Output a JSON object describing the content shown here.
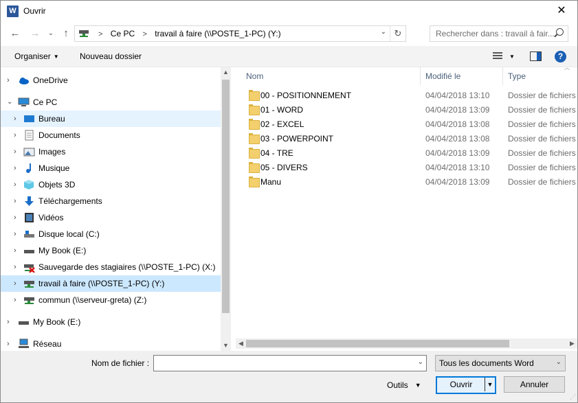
{
  "window": {
    "title": "Ouvrir",
    "app_icon_letter": "W",
    "close_glyph": "✕"
  },
  "nav_buttons": {
    "back": "←",
    "forward": "→",
    "down": "⌄",
    "up": "↑"
  },
  "address": {
    "crumbs": [
      "Ce PC",
      "travail à faire (\\\\POSTE_1-PC) (Y:)"
    ],
    "separator": ">",
    "dropdown": "⌄",
    "refresh": "↻"
  },
  "search": {
    "placeholder": "Rechercher dans : travail à fair..."
  },
  "toolbar": {
    "organize": "Organiser",
    "new_folder": "Nouveau dossier",
    "help": "?"
  },
  "sidebar": {
    "items": [
      {
        "label": "OneDrive",
        "icon": "cloud-icon",
        "level": 0,
        "expanded": false
      },
      {
        "label": "Ce PC",
        "icon": "computer-icon",
        "level": 0,
        "expanded": true
      },
      {
        "label": "Bureau",
        "icon": "desktop-icon",
        "level": 1,
        "state": "hover"
      },
      {
        "label": "Documents",
        "icon": "documents-icon",
        "level": 1
      },
      {
        "label": "Images",
        "icon": "images-icon",
        "level": 1
      },
      {
        "label": "Musique",
        "icon": "music-icon",
        "level": 1
      },
      {
        "label": "Objets 3D",
        "icon": "cube-icon",
        "level": 1
      },
      {
        "label": "Téléchargements",
        "icon": "download-icon",
        "level": 1
      },
      {
        "label": "Vidéos",
        "icon": "video-icon",
        "level": 1
      },
      {
        "label": "Disque local (C:)",
        "icon": "drive-icon",
        "level": 1
      },
      {
        "label": "My Book (E:)",
        "icon": "drive-icon",
        "level": 1
      },
      {
        "label": "Sauvegarde des stagiaires (\\\\POSTE_1-PC) (X:)",
        "icon": "network-drive-disconnected-icon",
        "level": 1
      },
      {
        "label": "travail à faire (\\\\POSTE_1-PC) (Y:)",
        "icon": "network-drive-icon",
        "level": 1,
        "state": "selected"
      },
      {
        "label": "commun (\\\\serveur-greta) (Z:)",
        "icon": "network-drive-icon",
        "level": 1
      },
      {
        "label": "My Book (E:)",
        "icon": "drive-icon",
        "level": 0
      },
      {
        "label": "Réseau",
        "icon": "network-icon",
        "level": 0
      }
    ]
  },
  "columns": {
    "name": "Nom",
    "modified": "Modifié le",
    "type": "Type"
  },
  "files": [
    {
      "name": "00 - POSITIONNEMENT",
      "modified": "04/04/2018 13:10",
      "type": "Dossier de fichiers"
    },
    {
      "name": "01 - WORD",
      "modified": "04/04/2018 13:09",
      "type": "Dossier de fichiers"
    },
    {
      "name": "02 - EXCEL",
      "modified": "04/04/2018 13:08",
      "type": "Dossier de fichiers"
    },
    {
      "name": "03 - POWERPOINT",
      "modified": "04/04/2018 13:08",
      "type": "Dossier de fichiers"
    },
    {
      "name": "04 - TRE",
      "modified": "04/04/2018 13:09",
      "type": "Dossier de fichiers"
    },
    {
      "name": "05 - DIVERS",
      "modified": "04/04/2018 13:10",
      "type": "Dossier de fichiers"
    },
    {
      "name": "Manu",
      "modified": "04/04/2018 13:09",
      "type": "Dossier de fichiers"
    }
  ],
  "footer": {
    "filename_label": "Nom de fichier :",
    "filename_value": "",
    "filetype": "Tous les documents Word",
    "tools": "Outils",
    "open": "Ouvrir",
    "cancel": "Annuler"
  },
  "colors": {
    "accent": "#0078d7",
    "selected_bg": "#cce8ff",
    "hover_bg": "#e5f3ff",
    "folder": "#f3cf6d"
  }
}
